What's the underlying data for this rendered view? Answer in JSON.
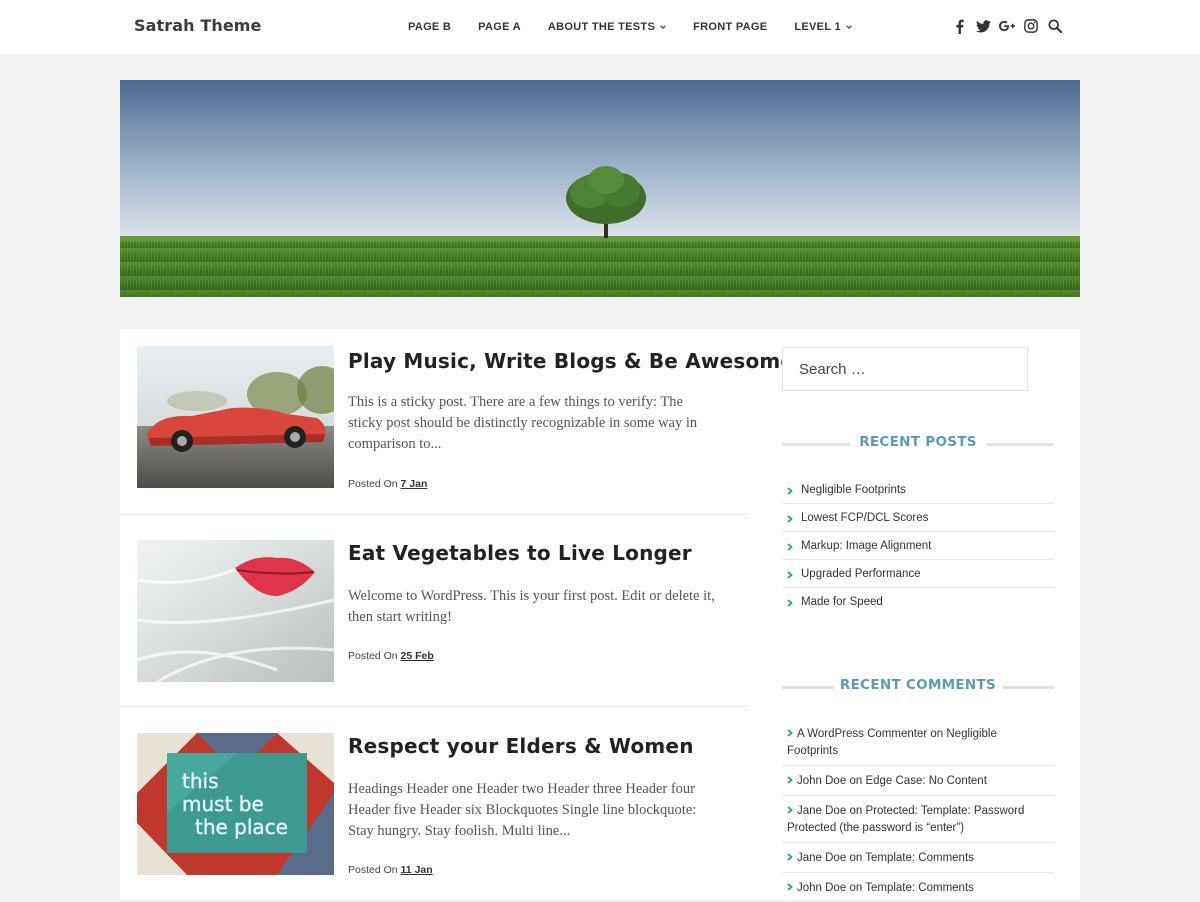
{
  "header": {
    "brand": "Satrah Theme",
    "nav": [
      {
        "label": "PAGE B",
        "dropdown": false
      },
      {
        "label": "PAGE A",
        "dropdown": false
      },
      {
        "label": "ABOUT THE TESTS",
        "dropdown": true
      },
      {
        "label": "FRONT PAGE",
        "dropdown": false
      },
      {
        "label": "LEVEL 1",
        "dropdown": true
      }
    ],
    "socials": [
      "facebook-icon",
      "twitter-icon",
      "google-plus-icon",
      "instagram-icon",
      "search-icon"
    ]
  },
  "posts": [
    {
      "title": "Play Music, Write Blogs & Be Awesome",
      "excerpt": "This is a sticky post. There are a few things to verify: The sticky post should be distinctly recognizable in some way in comparison to...",
      "meta_prefix": "Posted On",
      "date": "7 Jan",
      "thumb": "red-convertible-car"
    },
    {
      "title": "Eat Vegetables to Live Longer",
      "excerpt": "Welcome to WordPress. This is your first post. Edit or delete it, then start writing!",
      "meta_prefix": "Posted On",
      "date": "25 Feb",
      "thumb": "red-lips-white-hair"
    },
    {
      "title": "Respect your Elders & Women",
      "excerpt": "Headings Header one Header two Header three Header four Header five Header six Blockquotes Single line blockquote: Stay hungry. Stay foolish. Multi line...",
      "meta_prefix": "Posted On",
      "date": "11 Jan",
      "thumb": "neon-sign-wall"
    }
  ],
  "sidebar": {
    "search_placeholder": "Search …",
    "recent_posts_title": "RECENT POSTS",
    "recent_posts": [
      "Negligible Footprints",
      "Lowest FCP/DCL Scores",
      "Markup: Image Alignment",
      "Upgraded Performance",
      "Made for Speed"
    ],
    "recent_comments_title": "RECENT COMMENTS",
    "recent_comments": [
      {
        "author": "A WordPress Commenter",
        "on": "on",
        "post": "Negligible Footprints"
      },
      {
        "author": "John Doe",
        "on": "on",
        "post": "Edge Case: No Content"
      },
      {
        "author": "Jane Doe",
        "on": "on",
        "post": "Protected: Template: Password Protected (the password is “enter”)"
      },
      {
        "author": "Jane Doe",
        "on": "on",
        "post": "Template: Comments"
      },
      {
        "author": "John Doe",
        "on": "on",
        "post": "Template: Comments"
      }
    ]
  },
  "colors": {
    "accent": "#5a9bb0",
    "arrow": "#2a9d8f",
    "background": "#f2f2f2"
  },
  "hero": {
    "image": "lone-tree-in-green-field"
  }
}
